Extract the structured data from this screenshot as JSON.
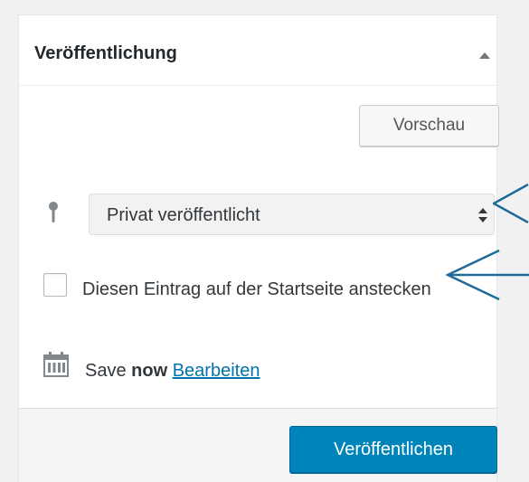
{
  "panel": {
    "title": "Veröffentlichung",
    "toggle_icon": "triangle-up-icon"
  },
  "preview_button": {
    "label": "Vorschau"
  },
  "visibility": {
    "icon": "pin-icon",
    "selected_value": "Privat veröffentlicht",
    "caret_icon": "select-up-down-icon"
  },
  "sticky": {
    "checked": false,
    "label": "Diesen Eintrag auf der Startseite anstecken"
  },
  "schedule": {
    "icon": "calendar-icon",
    "prefix": "Save",
    "status": "now",
    "edit_link": "Bearbeiten"
  },
  "publish_button": {
    "label": "Veröffentlichen"
  },
  "colors": {
    "primary_button": "#0085ba",
    "link": "#0073aa",
    "annotation_arrow": "#1e6b99"
  }
}
